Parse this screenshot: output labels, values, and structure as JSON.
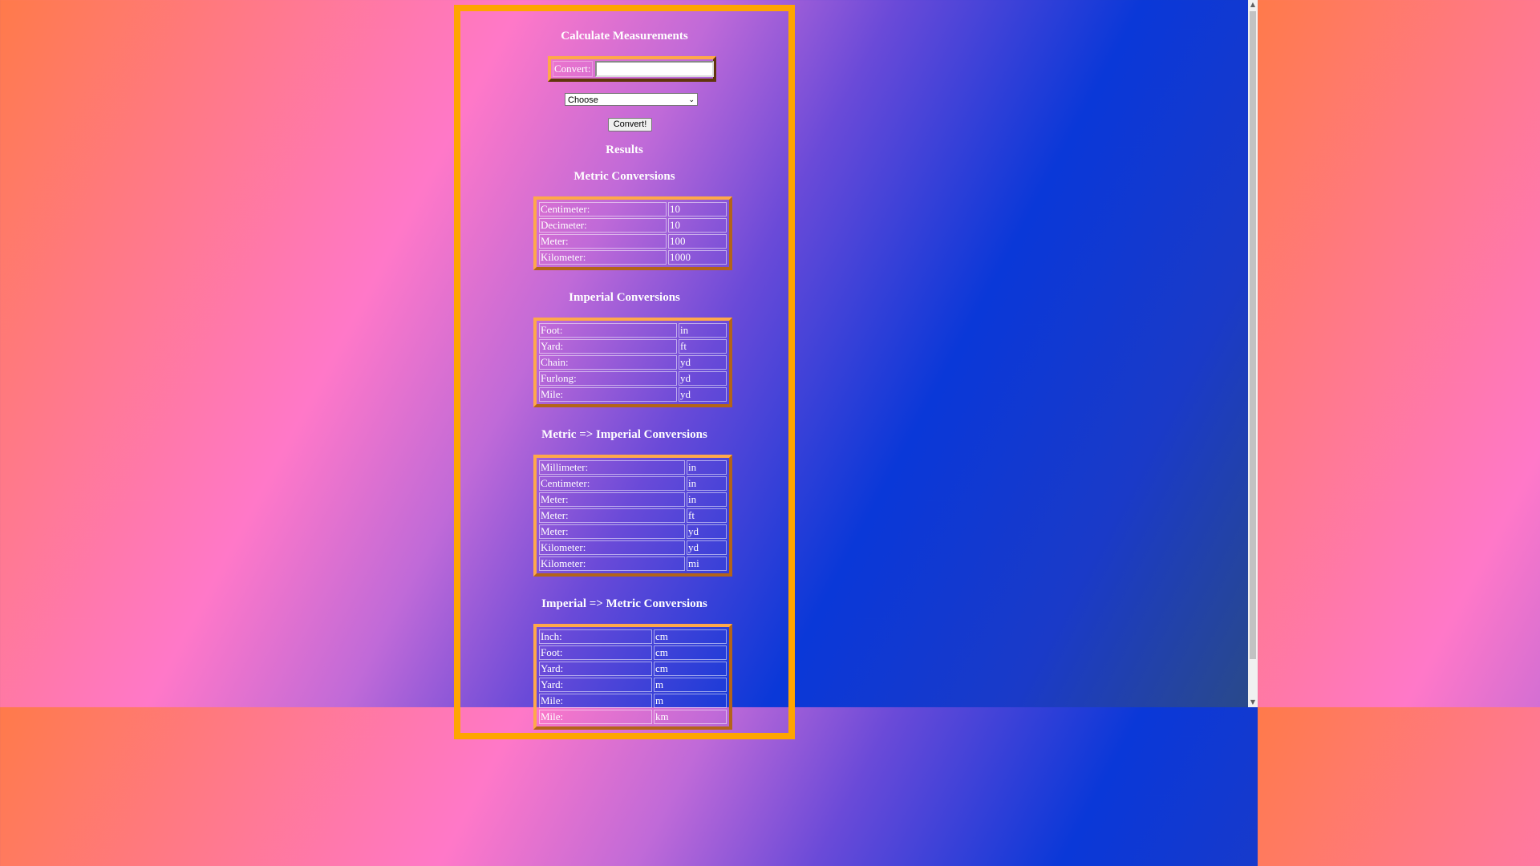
{
  "page": {
    "title": "Calculate Measurements",
    "convert_label": "Convert:",
    "convert_value": "",
    "select_value": "Choose",
    "convert_button": "Convert!",
    "results_heading": "Results"
  },
  "sections": [
    {
      "heading": "Metric Conversions",
      "rows": [
        {
          "label": "Centimeter:",
          "value": "10"
        },
        {
          "label": "Decimeter:",
          "value": "10"
        },
        {
          "label": "Meter:",
          "value": "100"
        },
        {
          "label": "Kilometer:",
          "value": "1000"
        }
      ]
    },
    {
      "heading": "Imperial Conversions",
      "rows": [
        {
          "label": "Foot:",
          "value": "in"
        },
        {
          "label": "Yard:",
          "value": "ft"
        },
        {
          "label": "Chain:",
          "value": "yd"
        },
        {
          "label": "Furlong:",
          "value": "yd"
        },
        {
          "label": "Mile:",
          "value": "yd"
        }
      ]
    },
    {
      "heading": "Metric => Imperial Conversions",
      "rows": [
        {
          "label": "Millimeter:",
          "value": "in"
        },
        {
          "label": "Centimeter:",
          "value": "in"
        },
        {
          "label": "Meter:",
          "value": "in"
        },
        {
          "label": "Meter:",
          "value": "ft"
        },
        {
          "label": "Meter:",
          "value": "yd"
        },
        {
          "label": "Kilometer:",
          "value": "yd"
        },
        {
          "label": "Kilometer:",
          "value": "mi"
        }
      ]
    },
    {
      "heading": "Imperial => Metric Conversions",
      "rows": [
        {
          "label": "Inch:",
          "value": "cm"
        },
        {
          "label": "Foot:",
          "value": "cm"
        },
        {
          "label": "Yard:",
          "value": "cm"
        },
        {
          "label": "Yard:",
          "value": "m"
        },
        {
          "label": "Mile:",
          "value": "m"
        },
        {
          "label": "Mile:",
          "value": "km"
        }
      ]
    }
  ],
  "colors": {
    "panel_border": "#ffa500",
    "table_border": "#c4792a"
  }
}
